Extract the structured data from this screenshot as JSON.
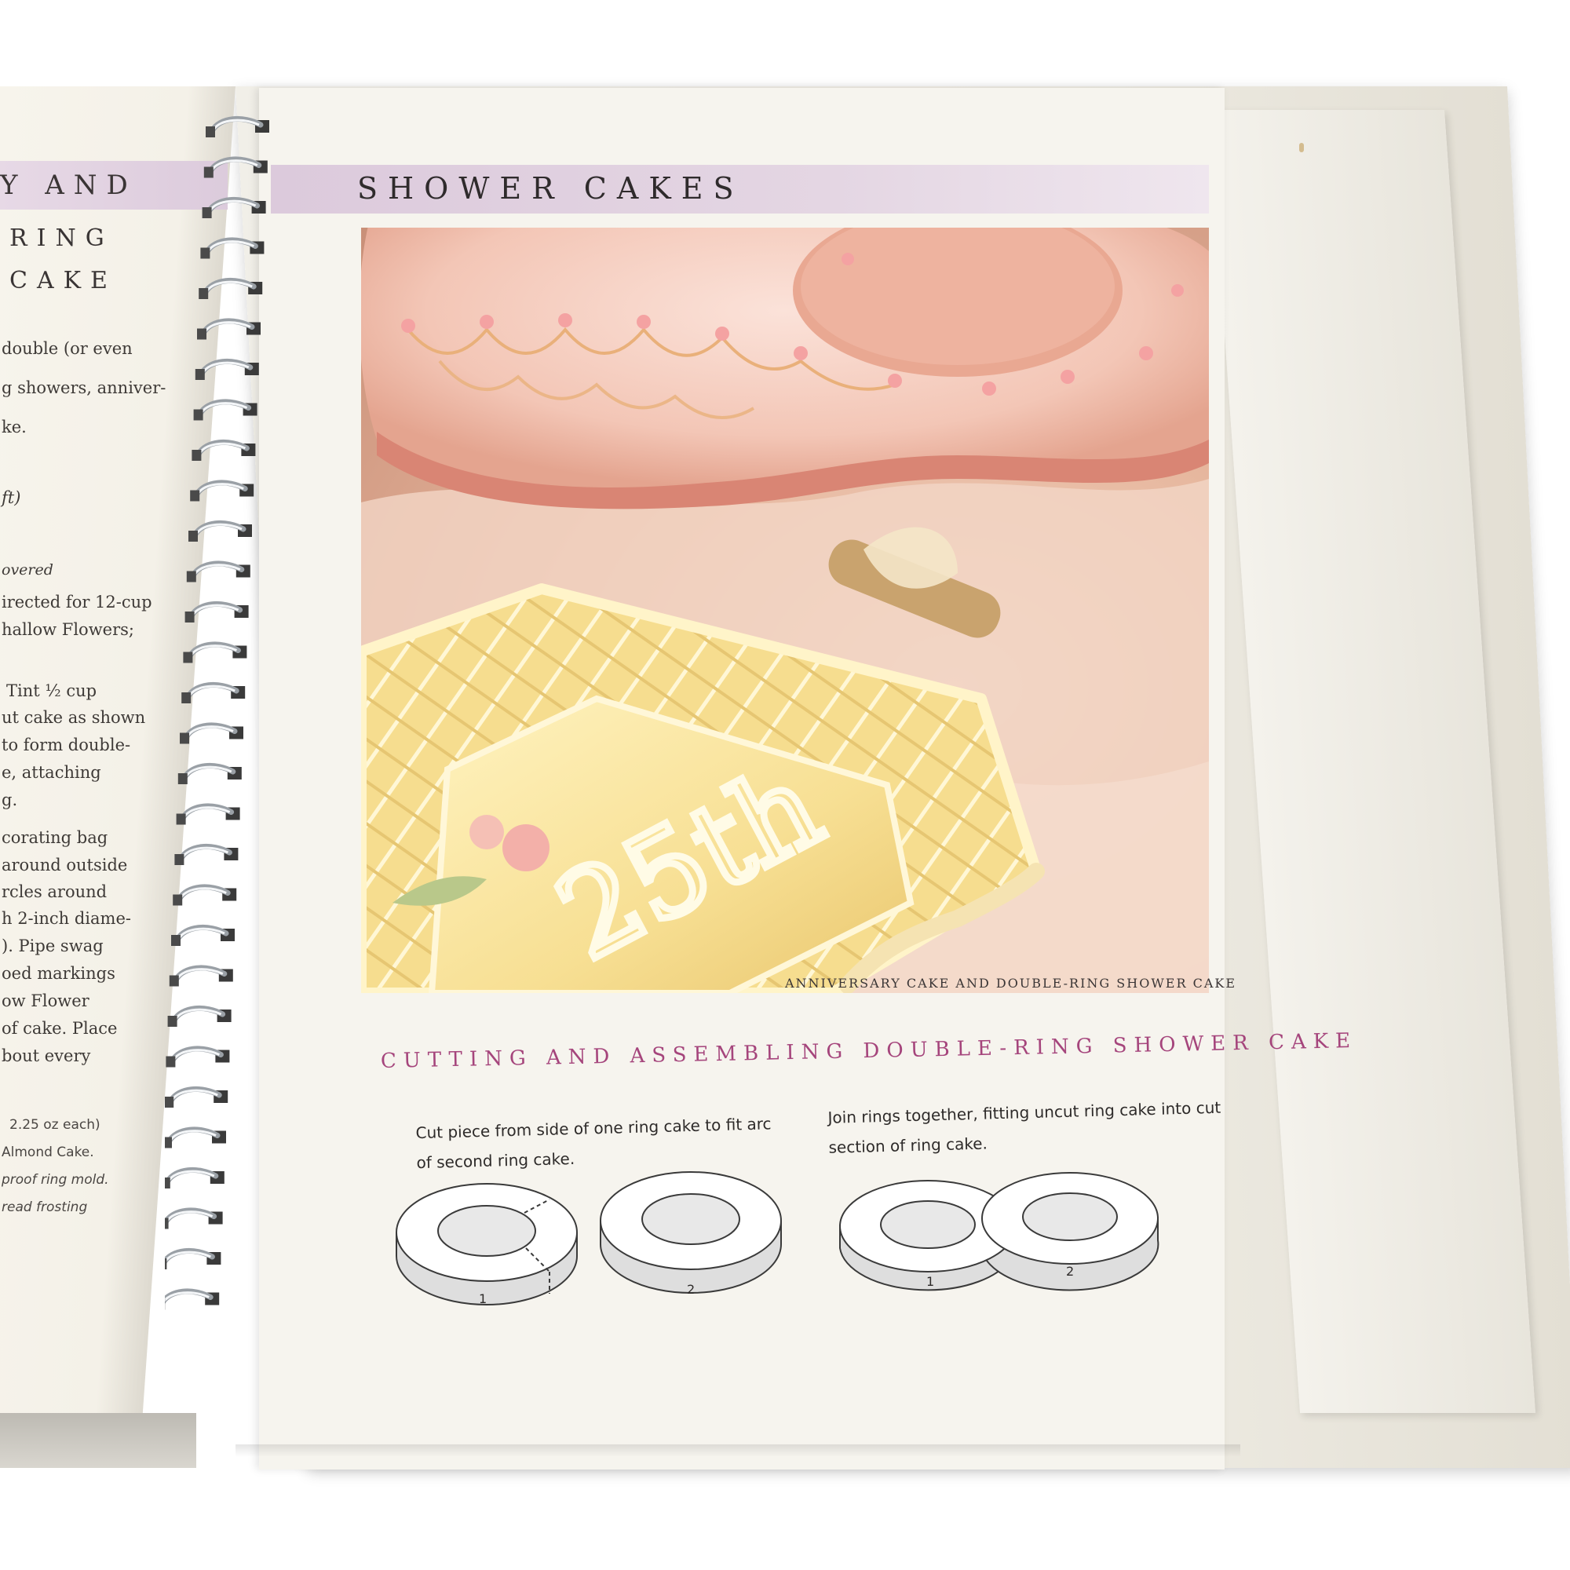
{
  "left_page": {
    "band_text": "Y AND",
    "heading_line1": "RING",
    "heading_line2": "CAKE",
    "text_lines": [
      "double (or even",
      "g showers, anniver-",
      "ke.",
      "ft)",
      "overed",
      "irected for 12-cup",
      "hallow Flowers;",
      "Tint ½ cup",
      "ut cake as shown",
      "to form double-",
      "e, attaching",
      "g.",
      "corating bag",
      "around outside",
      "rcles around",
      "h 2-inch diame-",
      "). Pipe swag",
      "oed markings",
      "ow Flower",
      "of cake. Place",
      "bout every"
    ],
    "small_lines": [
      "2.25 oz each)",
      "Almond Cake.",
      "proof ring mold.",
      "read frosting"
    ]
  },
  "right_page": {
    "header": "SHOWER CAKES",
    "photo_caption": "ANNIVERSARY CAKE AND DOUBLE-RING SHOWER CAKE",
    "photo_cake_text": "25th",
    "section_title": "CUTTING AND ASSEMBLING DOUBLE-RING SHOWER CAKE",
    "instruction_1": "Cut piece from side of one ring cake to fit arc of second ring cake.",
    "instruction_2": "Join rings together, fitting uncut ring cake into cut section of ring cake.",
    "diagram_labels": [
      "1",
      "2",
      "1",
      "2"
    ]
  },
  "colors": {
    "band_lavender": "#dccadc",
    "section_title_magenta": "#a5457c",
    "page_cream": "#f6f4ee"
  }
}
